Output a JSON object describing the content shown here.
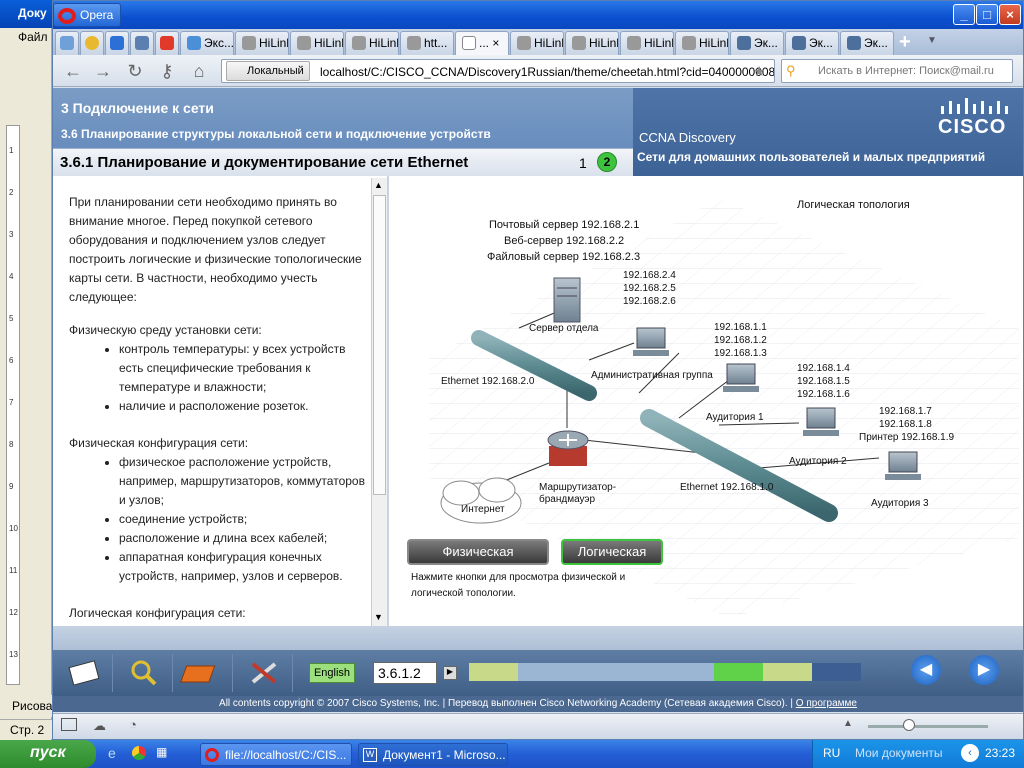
{
  "word": {
    "title": "Доку",
    "menu_file": "Файл",
    "draw": "Рисова",
    "status_page": "Стр. 2",
    "ruler": [
      "1",
      "2",
      "3",
      "4",
      "5",
      "6",
      "7",
      "8",
      "9",
      "10",
      "11",
      "12",
      "13"
    ]
  },
  "opera": {
    "menu_label": "Opera",
    "tabs": [
      "Экс...",
      "HiLink",
      "HiLink",
      "HiLink",
      "htt...",
      "...",
      "HiLink",
      "HiLink",
      "HiLink",
      "HiLink",
      "Эк...",
      "Эк...",
      "Эк..."
    ],
    "address_local": "Локальный",
    "address": "localhost/C:/CISCO_CCNA/Discovery1Russian/theme/cheetah.html?cid=0400000008&l1",
    "search_placeholder": "Искать в Интернет: Поиск@mail.ru"
  },
  "course": {
    "chapter": "3 Подключение к сети",
    "section": "3.6 Планирование структуры локальной сети и подключение устройств",
    "brand_line1": "CCNA Discovery",
    "brand_line2": "Сети для домашних пользователей и малых предприятий",
    "cisco": "CISCO",
    "page_title": "3.6.1 Планирование и документирование сети Ethernet",
    "page_1": "1",
    "page_2": "2",
    "intro": "При планировании сети необходимо принять во внимание многое. Перед покупкой сетевого оборудования и подключением узлов следует построить логические и физические топологические карты сети. В частности, необходимо учесть следующее:",
    "physical_env_title": "Физическую среду установки сети:",
    "physical_env": [
      "контроль температуры: у всех устройств есть специфические требования к температуре и влажности;",
      "наличие и расположение розеток."
    ],
    "physical_cfg_title": "Физическая конфигурация сети:",
    "physical_cfg": [
      "физическое расположение устройств, например, маршрутизаторов, коммутаторов и узлов;",
      "соединение устройств;",
      "расположение и длина всех кабелей;",
      "аппаратная конфигурация конечных устройств, например, узлов и серверов."
    ],
    "logical_cfg_title": "Логическая конфигурация сети:"
  },
  "diagram": {
    "heading": "Логическая топология",
    "servers_info": [
      "Почтовый сервер 192.168.2.1",
      "Веб-сервер 192.168.2.2",
      "Файловый сервер 192.168.2.3"
    ],
    "admin_ips": [
      "192.168.2.4",
      "192.168.2.5",
      "192.168.2.6"
    ],
    "dept_server": "Сервер отдела",
    "admin_group": "Административная группа",
    "eth2": "Ethernet  192.168.2.0",
    "eth1": "Ethernet 192.168.1.0",
    "room1_ips": [
      "192.168.1.1",
      "192.168.1.2",
      "192.168.1.3"
    ],
    "room2_ips": [
      "192.168.1.4",
      "192.168.1.5",
      "192.168.1.6"
    ],
    "room3_ips": [
      "192.168.1.7",
      "192.168.1.8"
    ],
    "printer": "Принтер 192.168.1.9",
    "room1": "Аудитория 1",
    "room2": "Аудитория 2",
    "room3": "Аудитория 3",
    "router": [
      "Маршрутизатор-",
      "брандмауэр"
    ],
    "internet": "Интернет",
    "btn_physical": "Физическая",
    "btn_logical": "Логическая",
    "hint": [
      "Нажмите кнопки для просмотра физической и",
      "логической топологии."
    ]
  },
  "footer": {
    "english": "English",
    "page_number": "3.6.1.2",
    "copyright": "All contents copyright © 2007 Cisco Systems, Inc. | Перевод выполнен Cisco Networking Academy (Сетевая академия Cisco). | ",
    "about": "О программе",
    "progress_colors": [
      "#c8d98a",
      "#9bb6d2",
      "#9bb6d2",
      "#9bb6d2",
      "#9bb6d2",
      "#5fd24a",
      "#c8d98a",
      "#3c5e93"
    ]
  },
  "taskbar": {
    "start": "пуск",
    "task1": "file://localhost/C:/CIS...",
    "task2": "Документ1 - Microso...",
    "lang": "RU",
    "docs": "Мои документы",
    "clock": "23:23"
  }
}
